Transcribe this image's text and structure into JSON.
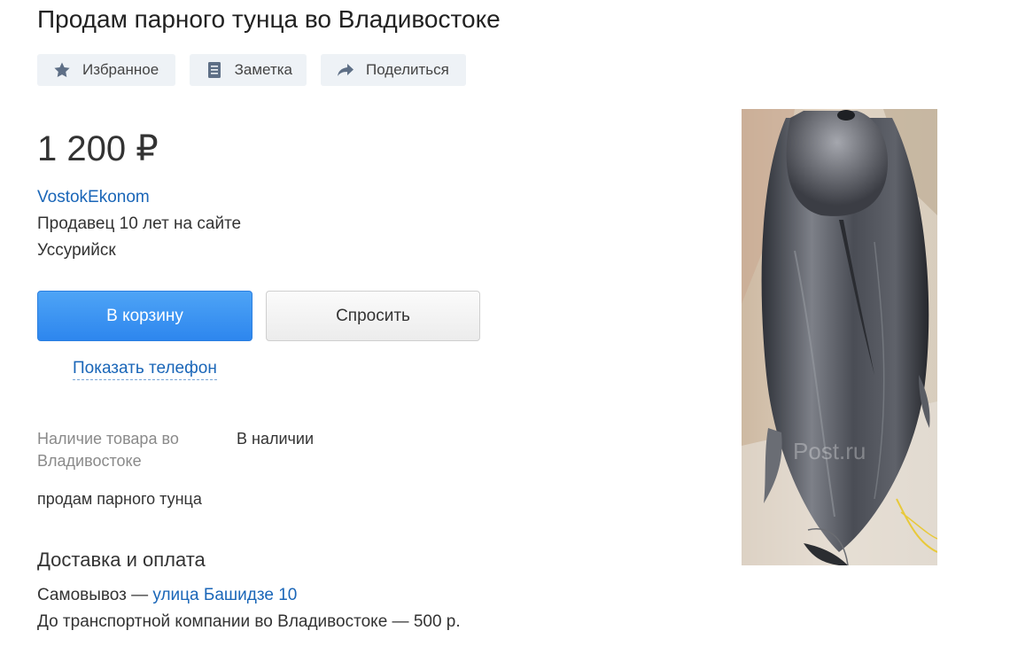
{
  "listing": {
    "title": "Продам парного тунца во Владивостоке",
    "price": "1 200 ₽",
    "description": "продам парного тунца"
  },
  "actions": {
    "favorite_label": "Избранное",
    "note_label": "Заметка",
    "share_label": "Поделиться",
    "favorite_icon": "star-icon",
    "note_icon": "note-icon",
    "share_icon": "share-arrow-icon"
  },
  "seller": {
    "name": "VostokEkonom",
    "since": "Продавец 10 лет на сайте",
    "city": "Уссурийск"
  },
  "buttons": {
    "cart_label": "В корзину",
    "ask_label": "Спросить",
    "show_phone_label": "Показать телефон"
  },
  "availability": {
    "label": "Наличие товара во Владивостоке",
    "value": "В наличии"
  },
  "delivery": {
    "heading": "Доставка и оплата",
    "pickup_prefix": "Самовывоз — ",
    "pickup_address": "улица Башидзе 10",
    "transport": "До транспортной компании во Владивостоке — 500 р."
  },
  "photo": {
    "watermark": "Post.ru"
  },
  "colors": {
    "link": "#1a66b8",
    "primary_button": "#3b92f2",
    "action_bg": "#eef2f6",
    "icon": "#5e6f86"
  }
}
